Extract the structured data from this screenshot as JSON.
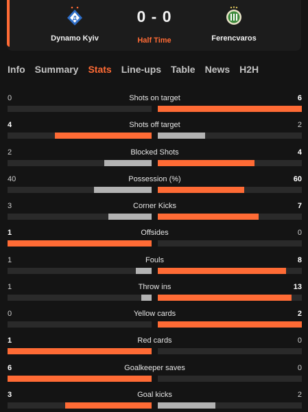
{
  "match": {
    "home": {
      "name": "Dynamo Kyiv",
      "logo_icon": "dynamo-kyiv-crest-icon"
    },
    "away": {
      "name": "Ferencvaros",
      "logo_icon": "ferencvaros-crest-icon"
    },
    "score": "0 - 0",
    "status": "Half Time"
  },
  "tabs": [
    {
      "label": "Info",
      "active": false
    },
    {
      "label": "Summary",
      "active": false
    },
    {
      "label": "Stats",
      "active": true
    },
    {
      "label": "Line-ups",
      "active": false
    },
    {
      "label": "Table",
      "active": false
    },
    {
      "label": "News",
      "active": false
    },
    {
      "label": "H2H",
      "active": false
    }
  ],
  "colors": {
    "accent": "#ff6b35",
    "loser": "#b3b3b3",
    "track": "#2a2a2a",
    "background": "#141414"
  },
  "stats": [
    {
      "label": "Shots on target",
      "home": "0",
      "away": "6",
      "home_frac": 0.0,
      "away_frac": 1.0
    },
    {
      "label": "Shots off target",
      "home": "4",
      "away": "2",
      "home_frac": 0.67,
      "away_frac": 0.33
    },
    {
      "label": "Blocked Shots",
      "home": "2",
      "away": "4",
      "home_frac": 0.33,
      "away_frac": 0.67
    },
    {
      "label": "Possession (%)",
      "home": "40",
      "away": "60",
      "home_frac": 0.4,
      "away_frac": 0.6
    },
    {
      "label": "Corner Kicks",
      "home": "3",
      "away": "7",
      "home_frac": 0.3,
      "away_frac": 0.7
    },
    {
      "label": "Offsides",
      "home": "1",
      "away": "0",
      "home_frac": 1.0,
      "away_frac": 0.0
    },
    {
      "label": "Fouls",
      "home": "1",
      "away": "8",
      "home_frac": 0.11,
      "away_frac": 0.89
    },
    {
      "label": "Throw ins",
      "home": "1",
      "away": "13",
      "home_frac": 0.07,
      "away_frac": 0.93
    },
    {
      "label": "Yellow cards",
      "home": "0",
      "away": "2",
      "home_frac": 0.0,
      "away_frac": 1.0
    },
    {
      "label": "Red cards",
      "home": "1",
      "away": "0",
      "home_frac": 1.0,
      "away_frac": 0.0
    },
    {
      "label": "Goalkeeper saves",
      "home": "6",
      "away": "0",
      "home_frac": 1.0,
      "away_frac": 0.0
    },
    {
      "label": "Goal kicks",
      "home": "3",
      "away": "2",
      "home_frac": 0.6,
      "away_frac": 0.4
    }
  ]
}
